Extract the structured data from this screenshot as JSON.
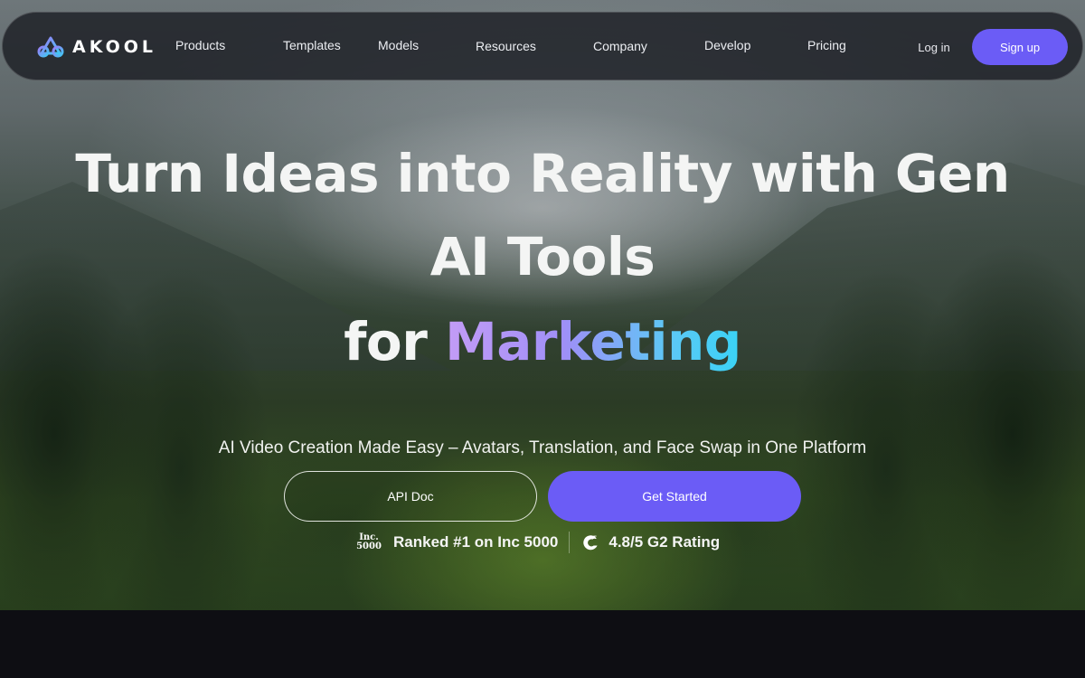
{
  "brand": {
    "name": "AKOOL",
    "accent": "#6b5cf6"
  },
  "nav": {
    "items": [
      "Products",
      "Templates",
      "Models",
      "Resources",
      "Company",
      "Develop",
      "Pricing"
    ],
    "login_label": "Log in",
    "signup_label": "Sign up"
  },
  "hero": {
    "headline": "Turn Ideas into Reality with Gen AI Tools",
    "sub_prefix": "for",
    "sub_highlight": "Marketing",
    "tagline": "AI Video Creation Made Easy – Avatars, Translation, and Face Swap in One Platform",
    "cta_secondary": "API Doc",
    "cta_primary": "Get Started"
  },
  "badges": {
    "inc_logo_line1": "Inc.",
    "inc_logo_line2": "5000",
    "inc_text": "Ranked #1 on Inc 5000",
    "g2_icon": "g2-icon",
    "g2_text": "4.8/5 G2 Rating"
  }
}
